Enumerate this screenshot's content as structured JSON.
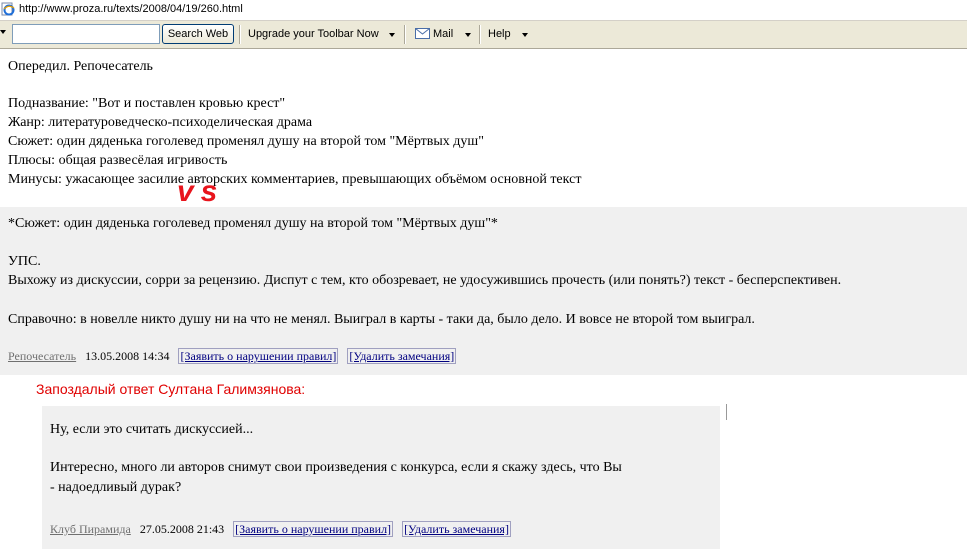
{
  "browser": {
    "url": "http://www.proza.ru/texts/2008/04/19/260.html"
  },
  "toolbar": {
    "search_value": "",
    "search_button": "Search Web",
    "upgrade_label": "Upgrade your Toolbar Now",
    "mail_label": "Mail",
    "help_label": "Help"
  },
  "review": {
    "line1": "Опередил. Репочесатель",
    "subtitle": "Подназвание: \"Вот и поставлен кровью крест\"",
    "genre": "Жанр: литературоведческо-психоделическая драма",
    "plot": "Сюжет: один дяденька гоголевед променял душу на второй том \"Мёртвых душ\"",
    "pluses": "Плюсы: общая развесёлая игривость",
    "minuses": "Минусы: ужасающее засилие авторских комментариев, превышающих объёмом основной текст"
  },
  "vs_overlay": "vs",
  "response": {
    "quote": "*Сюжет: один дяденька гоголевед променял душу на второй том \"Мёртвых душ\"*",
    "ups": "УПС.",
    "leave": "Выхожу из дискуссии, сорри за рецензию. Диспут с тем, кто обозревает, не удосужившись прочесть (или понять?) текст - бесперспективен.",
    "reference": "Справочно: в новелле никто душу ни на что не менял. Выиграл в карты - таки да, было дело. И вовсе не второй том выиграл.",
    "author": "Репочесатель",
    "date": "13.05.2008 14:34",
    "report_link": "[Заявить о нарушении правил]",
    "delete_link": "[Удалить замечания]"
  },
  "late_reply": {
    "title": "Запоздалый ответ Султана Галимзянова:",
    "line1": "Ну, если это считать дискуссией...",
    "line2": "Интересно, много ли авторов снимут свои произведения с конкурса, если я скажу здесь, что Вы",
    "line3": "- надоедливый дурак?",
    "author": "Клуб Пирамида",
    "date": "27.05.2008 21:43",
    "report_link": "[Заявить о нарушении правил]",
    "delete_link": "[Удалить замечания]"
  },
  "colors": {
    "vs": "#e8141c",
    "late_title": "#e00000",
    "box_bg": "#f0f0f0",
    "toolbar_bg": "#ece9d8"
  },
  "icons": [
    "ie-page-icon",
    "mail-icon",
    "dropdown-arrow-icon"
  ]
}
